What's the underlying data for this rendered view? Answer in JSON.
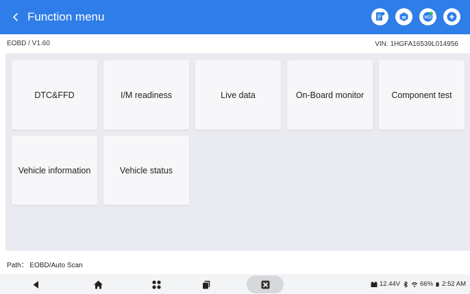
{
  "header": {
    "title": "Function menu",
    "bg_color": "#2f7de9",
    "icons": [
      "report-icon",
      "vehicle-icon",
      "vci-icon",
      "exit-icon"
    ]
  },
  "info": {
    "version": "EOBD / V1.60",
    "vin": "VIN: 1HGFA16539L014956"
  },
  "tiles": [
    "DTC&FFD",
    "I/M readiness",
    "Live data",
    "On-Board monitor",
    "Component test",
    "Vehicle information",
    "Vehicle status"
  ],
  "path": "Path： EOBD/Auto Scan",
  "status": {
    "voltage": "12.44V",
    "battery": "66%",
    "time": "2:52 AM"
  }
}
